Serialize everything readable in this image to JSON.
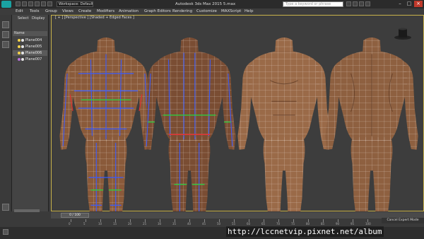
{
  "titlebar": {
    "workspace": "Workspace: Default",
    "title": "Autodesk 3ds Max 2015    5.max",
    "search_placeholder": "Type a keyword or phrase",
    "logo_text": "MAX"
  },
  "menu": [
    "Edit",
    "Tools",
    "Group",
    "Views",
    "Create",
    "Modifiers",
    "Animation",
    "Graph Editors",
    "Rendering",
    "Customize",
    "MAXScript",
    "Help"
  ],
  "explorer": {
    "tabs": [
      "Select",
      "Display"
    ],
    "header": "Name",
    "items": [
      "Plane004",
      "Plane005",
      "Plane006",
      "Plane007"
    ]
  },
  "viewport": {
    "label": "[ + ] [Perspective ] [Shaded + Edged Faces ]"
  },
  "timeline": {
    "frame": "0 / 100",
    "ticks": [
      "0",
      "5",
      "10",
      "15",
      "20",
      "25",
      "30",
      "35",
      "40",
      "45",
      "50",
      "55",
      "60",
      "65",
      "70",
      "75",
      "80",
      "85",
      "90",
      "95",
      "100"
    ]
  },
  "status": {
    "expert": "Cancel Expert Mode"
  },
  "watermark": "http://lccnetvip.pixnet.net/album",
  "colors": {
    "accent": "#c8b24a",
    "skin": "#8a5a3a",
    "wire_blue": "#3a5cff",
    "wire_green": "#2ecc40",
    "wire_red": "#e03030"
  }
}
